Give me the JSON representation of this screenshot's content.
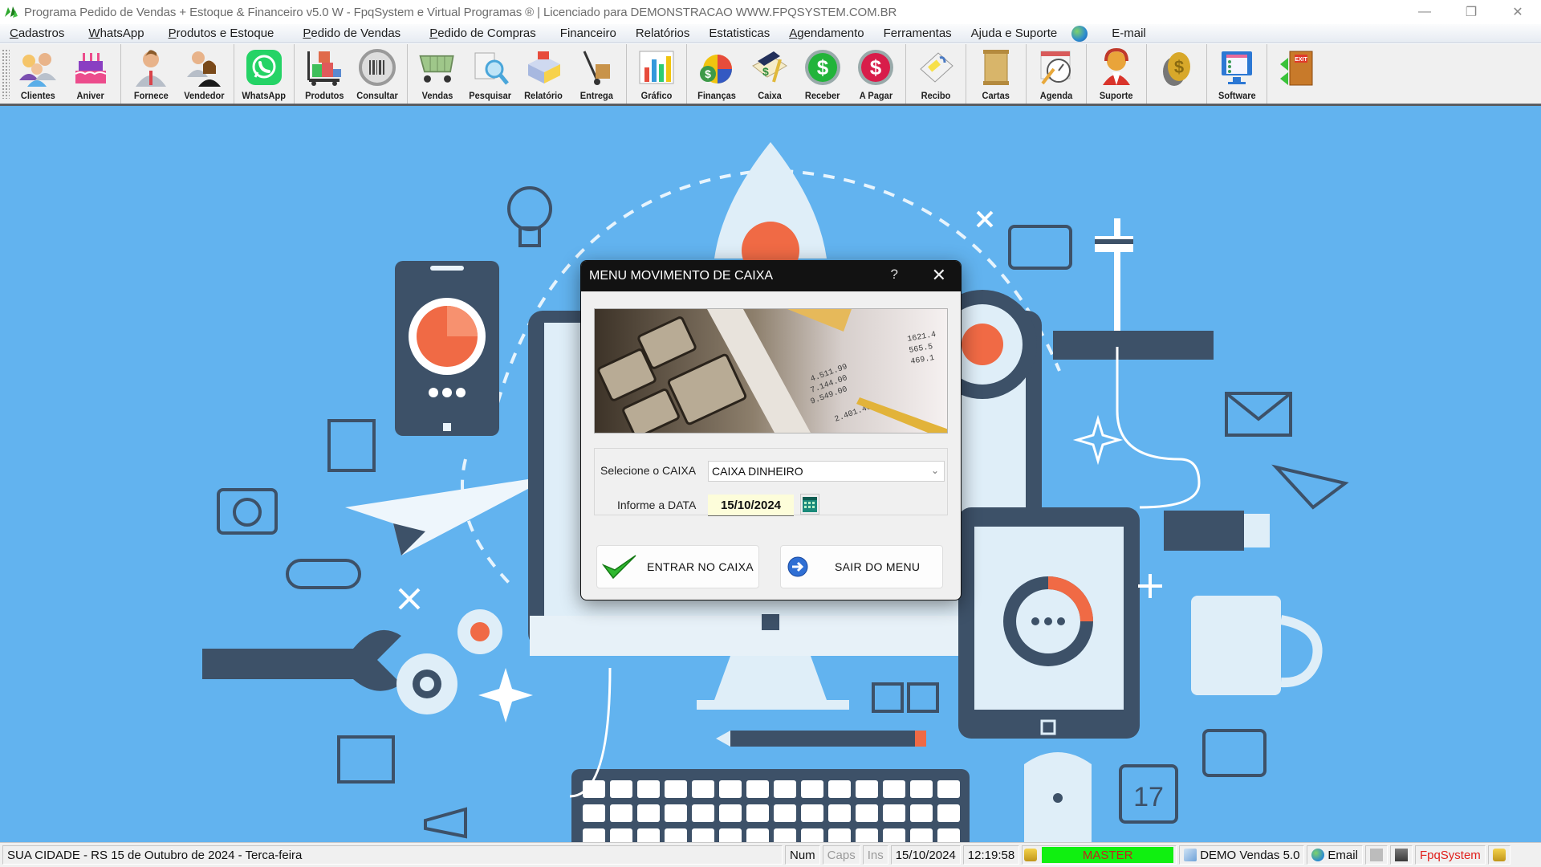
{
  "window": {
    "title": "Programa Pedido de Vendas + Estoque & Financeiro v5.0 W - FpqSystem e Virtual Programas ® | Licenciado para  DEMONSTRACAO WWW.FPQSYSTEM.COM.BR",
    "controls": {
      "minimize": "—",
      "restore": "❐",
      "close": "✕"
    }
  },
  "menubar": {
    "items": [
      {
        "label": "Cadastros",
        "key": "C",
        "rest": "adastros"
      },
      {
        "label": "WhatsApp",
        "key": "W",
        "rest": "hatsApp"
      },
      {
        "label": "Produtos e Estoque",
        "key": "P",
        "rest": "rodutos e Estoque"
      },
      {
        "label": "Pedido de Vendas",
        "key": "P",
        "rest": "edido de Vendas"
      },
      {
        "label": "Pedido de Compras",
        "key": "P",
        "rest": "edido de Compras"
      },
      {
        "label": "Financeiro",
        "key": "",
        "rest": "Financeiro"
      },
      {
        "label": "Relatórios",
        "key": "",
        "rest": "Relatórios"
      },
      {
        "label": "Estatisticas",
        "key": "",
        "rest": "Estatisticas"
      },
      {
        "label": "Agendamento",
        "key": "A",
        "rest": "gendamento"
      },
      {
        "label": "Ferramentas",
        "key": "",
        "rest": "Ferramentas"
      },
      {
        "label": "Ajuda e Suporte",
        "key": "",
        "rest": "Ajuda e Suporte"
      },
      {
        "label": "E-mail",
        "key": "",
        "rest": "E-mail"
      }
    ]
  },
  "toolbar": {
    "buttons": [
      {
        "label": "Clientes",
        "icon": "clients-icon"
      },
      {
        "label": "Aniver",
        "icon": "birthday-cake-icon"
      },
      {
        "label": "Fornece",
        "icon": "supplier-icon"
      },
      {
        "label": "Vendedor",
        "icon": "salesperson-icon"
      },
      {
        "label": "WhatsApp",
        "icon": "whatsapp-icon"
      },
      {
        "label": "Produtos",
        "icon": "products-cart-icon"
      },
      {
        "label": "Consultar",
        "icon": "barcode-icon"
      },
      {
        "label": "Vendas",
        "icon": "shopping-cart-icon"
      },
      {
        "label": "Pesquisar",
        "icon": "search-icon"
      },
      {
        "label": "Relatório",
        "icon": "report-icon"
      },
      {
        "label": "Entrega",
        "icon": "delivery-icon"
      },
      {
        "label": "Gráfico",
        "icon": "chart-icon"
      },
      {
        "label": "Finanças",
        "icon": "finance-icon"
      },
      {
        "label": "Caixa",
        "icon": "cashbook-icon"
      },
      {
        "label": "Receber",
        "icon": "receive-dollar-icon"
      },
      {
        "label": "A Pagar",
        "icon": "pay-dollar-icon"
      },
      {
        "label": "Recibo",
        "icon": "receipt-icon"
      },
      {
        "label": "Cartas",
        "icon": "letters-scroll-icon"
      },
      {
        "label": "Agenda",
        "icon": "calendar-clock-icon"
      },
      {
        "label": "Suporte",
        "icon": "support-icon"
      },
      {
        "label": "",
        "icon": "coin-icon"
      },
      {
        "label": "Software",
        "icon": "software-icon"
      },
      {
        "label": "",
        "icon": "exit-door-icon"
      }
    ]
  },
  "dialog": {
    "title": "MENU MOVIMENTO DE CAIXA",
    "help": "?",
    "close": "✕",
    "caixa_label": "Selecione o CAIXA",
    "caixa_value": "CAIXA DINHEIRO",
    "data_label": "Informe a DATA",
    "data_value": "15/10/2024",
    "enter_button": "ENTRAR NO CAIXA",
    "exit_button": "SAIR DO MENU"
  },
  "statusbar": {
    "location_date": "SUA CIDADE - RS 15 de Outubro de 2024 - Terca-feira",
    "num": "Num",
    "caps": "Caps",
    "ins": "Ins",
    "date": "15/10/2024",
    "time": "12:19:58",
    "user": "MASTER",
    "version": "DEMO Vendas 5.0",
    "email": "Email",
    "brand": "FpqSystem"
  },
  "colors": {
    "desktop_bg": "#62b3ef",
    "dialog_title_bg": "#121212",
    "master_bg": "#10f010",
    "master_text": "#c0261b",
    "brand_red": "#e0201c"
  }
}
